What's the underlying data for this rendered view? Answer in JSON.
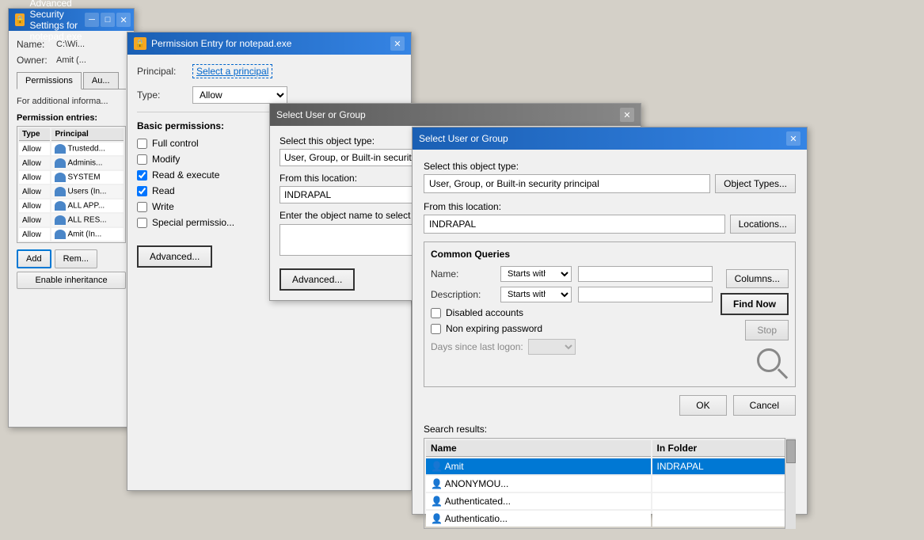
{
  "win_advanced": {
    "title": "Advanced Security Settings for notepad.exe",
    "fields": {
      "name_label": "Name:",
      "name_value": "C:\\Wi...",
      "owner_label": "Owner:",
      "owner_value": "Amit (...",
      "tab_permissions": "Permissions",
      "tab_audit": "Au...",
      "info_text": "For additional informa...",
      "perm_entries_label": "Permission entries:",
      "table_headers": [
        "Type",
        "Principal"
      ],
      "rows": [
        {
          "type": "Allow",
          "principal": "Trustedd..."
        },
        {
          "type": "Allow",
          "principal": "Adminis..."
        },
        {
          "type": "Allow",
          "principal": "SYSTEM..."
        },
        {
          "type": "Allow",
          "principal": "Users (In..."
        },
        {
          "type": "Allow",
          "principal": "ALL APP..."
        },
        {
          "type": "Allow",
          "principal": "ALL RES..."
        },
        {
          "type": "Allow",
          "principal": "Amit (In..."
        }
      ],
      "add_btn": "Add",
      "remove_btn": "Rem...",
      "enable_inheritance_btn": "Enable inheritance"
    }
  },
  "win_permission": {
    "title": "Permission Entry for notepad.exe",
    "principal_label": "Principal:",
    "principal_link": "Select a principal",
    "type_label": "Type:",
    "type_value": "Allow",
    "basic_perms_title": "Basic permissions:",
    "checkboxes": [
      {
        "label": "Full control",
        "checked": false
      },
      {
        "label": "Modify",
        "checked": false
      },
      {
        "label": "Read & execute",
        "checked": true
      },
      {
        "label": "Read",
        "checked": true
      },
      {
        "label": "Write",
        "checked": false
      },
      {
        "label": "Special permissio...",
        "checked": false
      }
    ],
    "advanced_btn": "Advanced..."
  },
  "win_select_small": {
    "title": "Select User or Group",
    "object_type_label": "Select this object type:",
    "object_type_value": "User, Group, or Built-in security p...",
    "from_location_label": "From this location:",
    "from_location_value": "INDRAPAL",
    "enter_name_label": "Enter the object name to select (ex...",
    "advanced_btn": "Advanced..."
  },
  "win_select_main": {
    "title": "Select User or Group",
    "object_type_label": "Select this object type:",
    "object_type_value": "User, Group, or Built-in security principal",
    "object_types_btn": "Object Types...",
    "from_location_label": "From this location:",
    "from_location_value": "INDRAPAL",
    "locations_btn": "Locations...",
    "common_queries_title": "Common Queries",
    "name_label": "Name:",
    "name_dropdown": "Starts with",
    "description_label": "Description:",
    "description_dropdown": "Starts with",
    "disabled_accounts_label": "Disabled accounts",
    "non_expiring_label": "Non expiring password",
    "days_since_label": "Days since last logon:",
    "columns_btn": "Columns...",
    "find_now_btn": "Find Now",
    "stop_btn": "Stop",
    "ok_btn": "OK",
    "cancel_btn": "Cancel",
    "search_results_label": "Search results:",
    "results_columns": [
      "Name",
      "In Folder"
    ],
    "results": [
      {
        "name": "Amit",
        "folder": "INDRAPAL",
        "selected": true
      },
      {
        "name": "ANONYMOU...",
        "folder": "",
        "selected": false
      },
      {
        "name": "Authenticated...",
        "folder": "",
        "selected": false
      },
      {
        "name": "Authenticatio...",
        "folder": "",
        "selected": false
      }
    ]
  }
}
